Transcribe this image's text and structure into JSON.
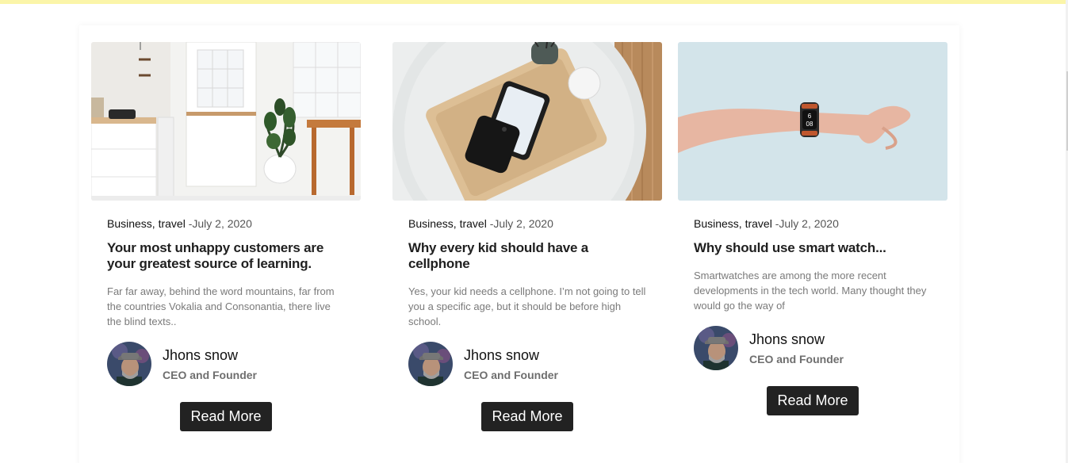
{
  "cards": [
    {
      "categories": "Business, travel",
      "date": "-July 2, 2020",
      "title": "Your most unhappy customers are your greatest source of learning.",
      "excerpt": "Far far away, behind the word mountains, far from the countries Vokalia and Consonantia, there live the blind texts..",
      "author_name": "Jhons snow",
      "author_role": "CEO and Founder",
      "button_label": "Read More",
      "image": "kitchen-interior-photo"
    },
    {
      "categories": "Business, travel",
      "date": "-July 2, 2020",
      "title": "Why every kid should have a cellphone",
      "excerpt": "Yes, your kid needs a cellphone. I’m not going to tell you a specific age, but it should be before high school.",
      "author_name": "Jhons snow",
      "author_role": "CEO and Founder",
      "button_label": "Read More",
      "image": "phone-on-wooden-tray-photo"
    },
    {
      "categories": "Business, travel",
      "date": "-July 2, 2020",
      "title": "Why should use smart watch...",
      "excerpt": "Smartwatches are among the more recent developments in the tech world. Many thought they would go the way of",
      "author_name": "Jhons snow",
      "author_role": "CEO and Founder",
      "button_label": "Read More",
      "image": "arm-with-smartwatch-photo"
    }
  ],
  "colors": {
    "top_strip": "#fbf5a9",
    "button_bg": "#222222",
    "button_text": "#ffffff"
  }
}
